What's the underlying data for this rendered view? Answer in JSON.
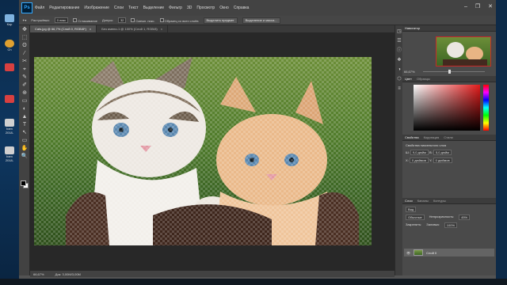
{
  "desktop": {
    "icons": [
      {
        "label": "Кор",
        "color": "#7fb3e0"
      },
      {
        "label": "Ch",
        "color": "#e0a030"
      },
      {
        "label": "",
        "color": "#d84040"
      },
      {
        "label": "",
        "color": "#d84040"
      },
      {
        "label": "bam",
        "color": "#d0d0d0"
      },
      {
        "label": "2018-",
        "color": ""
      },
      {
        "label": "bam",
        "color": "#d0d0d0"
      },
      {
        "label": "2018-",
        "color": ""
      }
    ]
  },
  "app": {
    "logo": "Ps",
    "menu": [
      "Файл",
      "Редактирование",
      "Изображение",
      "Слои",
      "Текст",
      "Выделение",
      "Фильтр",
      "3D",
      "Просмотр",
      "Окно",
      "Справка"
    ],
    "window_controls": [
      "–",
      "❐",
      "✕"
    ]
  },
  "options": {
    "style_label": "Растушёвка:",
    "style_value": "0 пикс",
    "smoothing_label": "Сглаживание",
    "tolerance_label": "Допуск:",
    "tolerance_value": "32",
    "contiguous_label": "Смежн. пикс.",
    "all_layers_label": "Образец со всех слоёв",
    "select_subject": "Выделить предмет",
    "select_mask": "Выделение и маска..."
  },
  "tabs": [
    {
      "label": "Cats.jpg @ 66,7% (Слой 0, RGB/8*)",
      "active": true
    },
    {
      "label": "Без имени-1 @ 100% (Слой 1, RGB/8)",
      "active": false
    }
  ],
  "tools": [
    "✥",
    "⬚",
    "ʘ",
    "⁄",
    "✂",
    "⌖",
    "✎",
    "✐",
    "⊕",
    "▭",
    "◐",
    "▲",
    "T",
    "↖",
    "▭",
    "✋",
    "🔍"
  ],
  "status": {
    "zoom": "66,67%",
    "doc": "Док: 3,00M/3,00M"
  },
  "dock": [
    "◳",
    "☰",
    "ⓘ",
    "❖",
    "◑",
    "⬡",
    "≡"
  ],
  "navigator": {
    "tabs": [
      "Навигатор"
    ],
    "zoom": "66,67%"
  },
  "color_panel": {
    "tabs": [
      "Цвет",
      "Образцы"
    ]
  },
  "properties": {
    "tabs": [
      "Свойства",
      "Коррекция",
      "Стили"
    ],
    "title": "Свойства пиксельного слоя",
    "w_label": "Ш:",
    "w_value": "9,0 дюйм",
    "h_label": "В:",
    "h_value": "5,0 дюйм",
    "x_label": "X:",
    "x_value": "0 дюймов",
    "y_label": "Y:",
    "y_value": "0 дюймов"
  },
  "layers": {
    "tabs": [
      "Слои",
      "Каналы",
      "Контуры"
    ],
    "kind": "Вид",
    "blend": "Обычные",
    "opacity_label": "Непрозрачность:",
    "opacity_value": "45%",
    "lock_label": "Закрепить:",
    "fill_label": "Заливка:",
    "fill_value": "100%",
    "layer_name": "Слой 0"
  }
}
